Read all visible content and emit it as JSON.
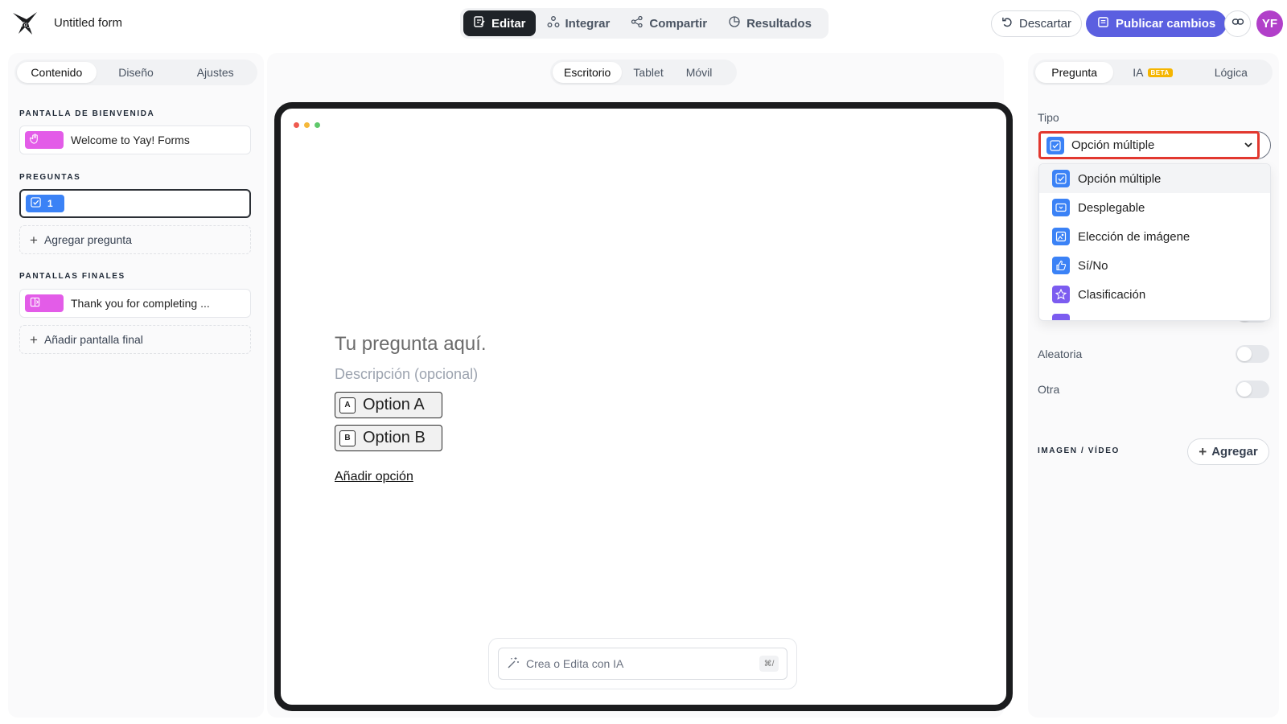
{
  "header": {
    "form_title": "Untitled form",
    "tabs": [
      {
        "label": "Editar",
        "icon": "edit-icon",
        "active": true
      },
      {
        "label": "Integrar",
        "icon": "integrations-icon",
        "active": false
      },
      {
        "label": "Compartir",
        "icon": "share-icon",
        "active": false
      },
      {
        "label": "Resultados",
        "icon": "results-icon",
        "active": false
      }
    ],
    "discard_label": "Descartar",
    "publish_label": "Publicar cambios",
    "avatar_initials": "YF",
    "colors": {
      "publish": "#5b5fe0",
      "avatar": "#b13fc9"
    }
  },
  "left": {
    "tabs": [
      "Contenido",
      "Diseño",
      "Ajustes"
    ],
    "active_tab": "Contenido",
    "welcome_label": "PANTALLA DE BIENVENIDA",
    "welcome_item": "Welcome to Yay! Forms",
    "questions_label": "PREGUNTAS",
    "question_number": "1",
    "add_question": "Agregar pregunta",
    "endings_label": "PANTALLAS FINALES",
    "ending_item": "Thank you for completing ...",
    "add_ending": "Añadir pantalla final"
  },
  "center": {
    "device_tabs": [
      "Escritorio",
      "Tablet",
      "Móvil"
    ],
    "active_device": "Escritorio",
    "question_title": "Tu pregunta aquí.",
    "question_desc": "Descripción (opcional)",
    "options": [
      {
        "key": "A",
        "label": "Option A"
      },
      {
        "key": "B",
        "label": "Option B"
      }
    ],
    "add_option": "Añadir opción",
    "ai_placeholder": "Crea o Edita con IA",
    "ai_shortcut": "⌘/"
  },
  "right": {
    "tabs": [
      "Pregunta",
      "IA",
      "Lógica"
    ],
    "active_tab": "Pregunta",
    "beta_badge": "BETA",
    "type_label": "Tipo",
    "type_selected": "Opción múltiple",
    "type_options": [
      {
        "label": "Opción múltiple",
        "icon": "checkbox-icon",
        "color": "#3b82f6"
      },
      {
        "label": "Desplegable",
        "icon": "dropdown-icon",
        "color": "#3b82f6"
      },
      {
        "label": "Elección de imágene",
        "icon": "image-choice-icon",
        "color": "#3b82f6"
      },
      {
        "label": "Sí/No",
        "icon": "thumbs-up-icon",
        "color": "#3b82f6"
      },
      {
        "label": "Clasificación",
        "icon": "star-icon",
        "color": "#7c5cf0"
      }
    ],
    "settings": [
      "Aleatoria",
      "Otra"
    ],
    "media_label": "IMAGEN / VÍDEO",
    "add_media": "Agregar"
  }
}
